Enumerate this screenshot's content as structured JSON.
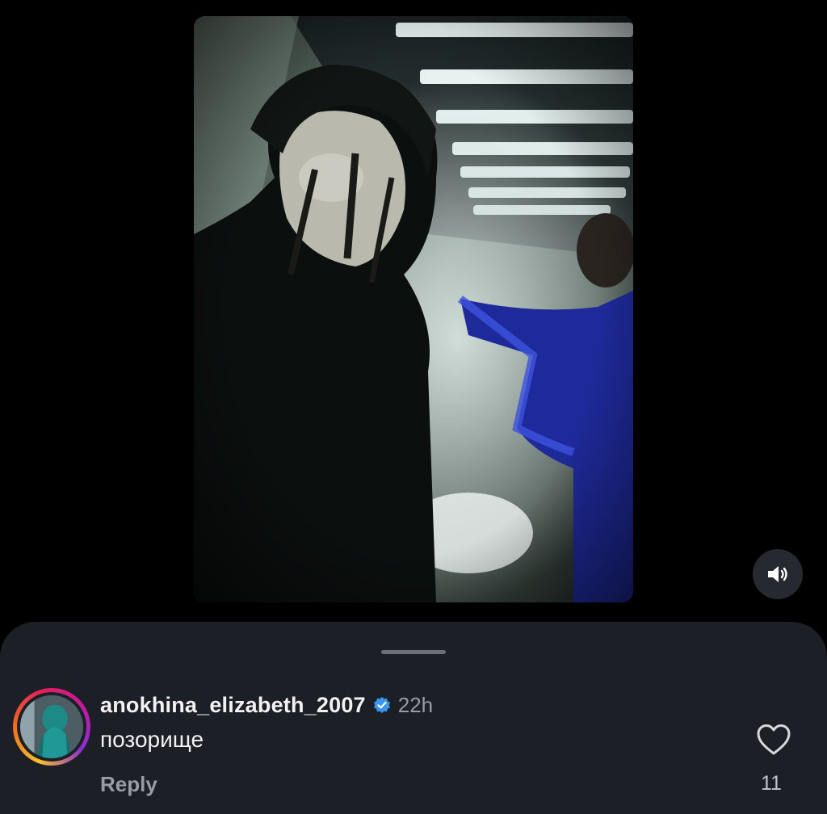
{
  "video": {
    "description_icon": "reel-video",
    "mute_icon": "speaker-icon"
  },
  "comment": {
    "username": "anokhina_elizabeth_2007",
    "verified": true,
    "time": "22h",
    "text": "позорище",
    "reply_label": "Reply",
    "like_count": "11"
  },
  "colors": {
    "background": "#000000",
    "sheet": "#1d1f26",
    "verified_badge": "#3897f0",
    "secondary_text": "#9a9ca3"
  }
}
